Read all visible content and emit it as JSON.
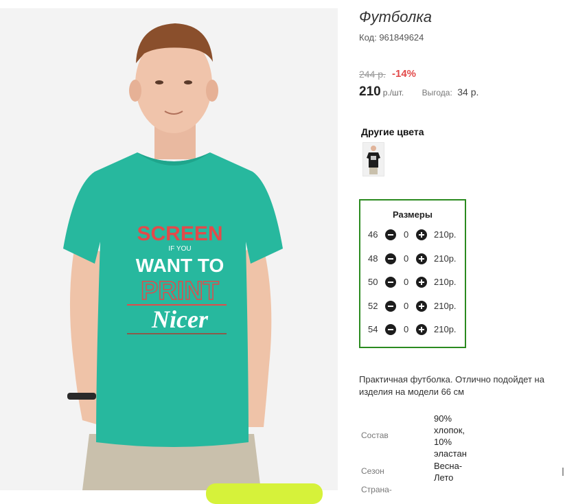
{
  "product": {
    "title": "Футболка",
    "code": "Код: 961849624",
    "old_price": "244 р.",
    "discount": "-14%",
    "price": "210",
    "price_unit": "р./шт.",
    "savings_label": "Выгода:",
    "savings_value": "34 р."
  },
  "tshirt_print": {
    "line1": "SCREEN",
    "line2": "IF YOU",
    "line3": "WANT TO",
    "line4": "PRINT",
    "line5": "Nicer"
  },
  "other_colors": {
    "title": "Другие цвета"
  },
  "sizes": {
    "title": "Размеры",
    "rows": [
      {
        "size": "46",
        "qty": "0",
        "price": "210р."
      },
      {
        "size": "48",
        "qty": "0",
        "price": "210р."
      },
      {
        "size": "50",
        "qty": "0",
        "price": "210р."
      },
      {
        "size": "52",
        "qty": "0",
        "price": "210р."
      },
      {
        "size": "54",
        "qty": "0",
        "price": "210р."
      }
    ]
  },
  "description": "Практичная футболка. Отлично подойдет на изделия на модели 66 см",
  "attributes": [
    {
      "label": "Состав",
      "value": "90% хлопок, 10% эластан"
    },
    {
      "label": "Сезон",
      "value": "Весна-Лето"
    },
    {
      "label": "Страна-",
      "value": ""
    }
  ],
  "colors": {
    "tshirt": "#27b89e",
    "border_green": "#2a8a1f",
    "discount_red": "#e24a4a",
    "button_lime": "#d6f23a"
  }
}
